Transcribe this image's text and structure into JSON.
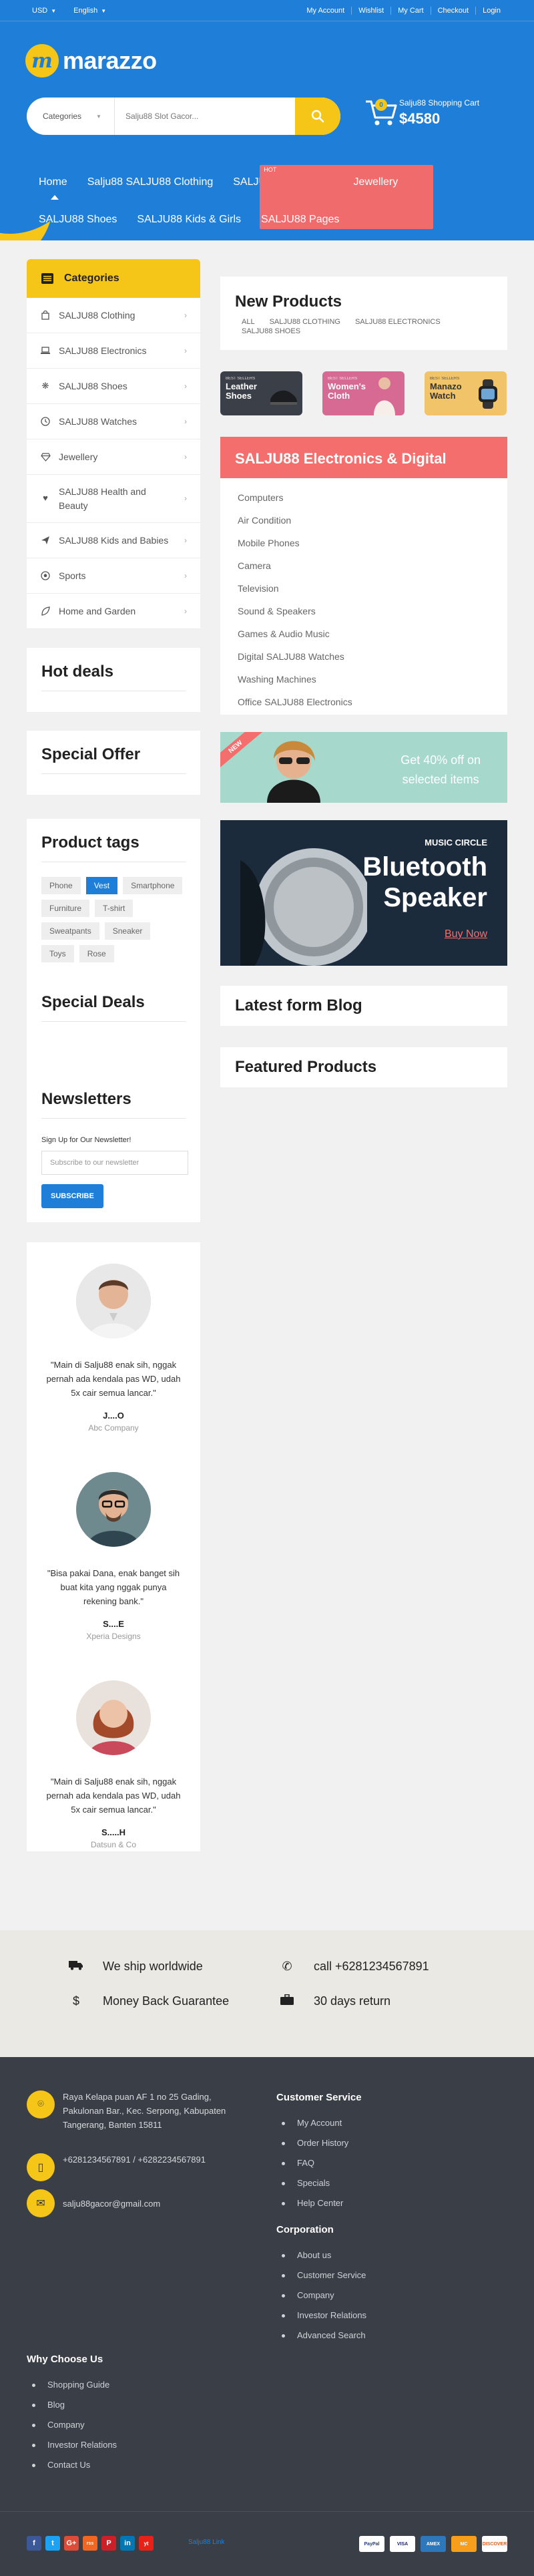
{
  "topbar": {
    "currency": "USD",
    "language": "English",
    "links": [
      "My Account",
      "Wishlist",
      "My Cart",
      "Checkout",
      "Login"
    ]
  },
  "header": {
    "logo_letter": "m",
    "logo_text": "marazzo",
    "search": {
      "category": "Categories",
      "placeholder": "Salju88 Slot Gacor..."
    },
    "cart": {
      "count": "0",
      "label": "Salju88 Shopping Cart",
      "total": "$4580"
    }
  },
  "nav": {
    "row1": [
      "Home",
      "Salju88 SALJU88 Clothing",
      "SALJU88 Electronics",
      "Jewellery"
    ],
    "row2": [
      "SALJU88 Shoes",
      "SALJU88 Kids & Girls",
      "SALJU88 Pages"
    ],
    "hot_badge": "HOT"
  },
  "categories": {
    "title": "Categories",
    "items": [
      {
        "icon": "shopping-bag-icon",
        "label": "SALJU88 Clothing"
      },
      {
        "icon": "laptop-icon",
        "label": "SALJU88 Electronics"
      },
      {
        "icon": "paw-icon",
        "label": "SALJU88 Shoes"
      },
      {
        "icon": "clock-icon",
        "label": "SALJU88 Watches"
      },
      {
        "icon": "diamond-icon",
        "label": "Jewellery"
      },
      {
        "icon": "heart-icon",
        "label": "SALJU88 Health and Beauty"
      },
      {
        "icon": "paper-plane-icon",
        "label": "SALJU88 Kids and Babies"
      },
      {
        "icon": "futbol-icon",
        "label": "Sports"
      },
      {
        "icon": "envira-icon",
        "label": "Home and Garden"
      }
    ]
  },
  "new_products": {
    "title": "New Products",
    "tabs": [
      "ALL",
      "SALJU88 CLOTHING",
      "SALJU88 ELECTRONICS",
      "SALJU88 SHOES"
    ]
  },
  "mini_banners": [
    {
      "small": "BEST SELLERS",
      "title": "Leather Shoes"
    },
    {
      "small": "BEST SELLERS",
      "title": "Women's Cloth"
    },
    {
      "small": "BEST SELLERS",
      "title": "Manazo Watch"
    }
  ],
  "electronics": {
    "title": "SALJU88 Electronics & Digital",
    "items": [
      "Computers",
      "Air Condition",
      "Mobile Phones",
      "Camera",
      "Television",
      "Sound & Speakers",
      "Games & Audio Music",
      "Digital SALJU88 Watches",
      "Washing Machines",
      "Office SALJU88 Electronics"
    ]
  },
  "offer_banner": {
    "ribbon": "NEW",
    "line1": "Get 40% off on",
    "line2": "selected items"
  },
  "bluetooth_banner": {
    "kicker": "MUSIC CIRCLE",
    "line1": "Bluetooth",
    "line2": "Speaker",
    "cta": "Buy Now"
  },
  "sections": {
    "hot_deals": "Hot deals",
    "special_offer": "Special Offer",
    "product_tags": "Product tags",
    "special_deals": "Special Deals",
    "latest_blog": "Latest form Blog",
    "featured": "Featured Products"
  },
  "tags": [
    "Phone",
    "Vest",
    "Smartphone",
    "Furniture",
    "T-shirt",
    "Sweatpants",
    "Sneaker",
    "Toys",
    "Rose"
  ],
  "active_tag": "Vest",
  "newsletter": {
    "title": "Newsletters",
    "subtitle": "Sign Up for Our Newsletter!",
    "placeholder": "Subscribe to our newsletter",
    "button": "SUBSCRIBE"
  },
  "testimonials": [
    {
      "quote": "\"Main di Salju88 enak sih, nggak pernah ada kendala pas WD, udah 5x cair semua lancar.\"",
      "name": "J....O",
      "company": "Abc Company"
    },
    {
      "quote": "\"Bisa pakai Dana, enak banget sih buat kita yang nggak punya rekening bank.\"",
      "name": "S....E",
      "company": "Xperia Designs"
    },
    {
      "quote": "\"Main di Salju88 enak sih, nggak pernah ada kendala pas WD, udah 5x cair semua lancar.\"",
      "name": "S.....H",
      "company": "Datsun & Co"
    }
  ],
  "ship": {
    "items": [
      {
        "icon": "truck-icon",
        "label": "We ship worldwide"
      },
      {
        "icon": "phone-icon",
        "label": "call +6281234567891"
      },
      {
        "icon": "dollar-icon",
        "label": "Money Back Guarantee"
      },
      {
        "icon": "briefcase-icon",
        "label": "30 days return"
      }
    ]
  },
  "footer": {
    "address": "Raya Kelapa puan AF 1 no 25 Gading, Pakulonan Bar., Kec. Serpong, Kabupaten Tangerang, Banten 15811",
    "phone": "+6281234567891 / +6282234567891",
    "email": "salju88gacor@gmail.com",
    "customer_service": {
      "title": "Customer Service",
      "links": [
        "My Account",
        "Order History",
        "FAQ",
        "Specials",
        "Help Center"
      ]
    },
    "corporation": {
      "title": "Corporation",
      "links": [
        "About us",
        "Customer Service",
        "Company",
        "Investor Relations",
        "Advanced Search"
      ]
    },
    "why": {
      "title": "Why Choose Us",
      "links": [
        "Shopping Guide",
        "Blog",
        "Company",
        "Investor Relations",
        "Contact Us"
      ]
    },
    "socials": [
      "f",
      "t",
      "G+",
      "rss",
      "P",
      "in",
      "yt"
    ],
    "sign": "Salju88 Link",
    "payments": [
      "PayPal",
      "VISA",
      "AMEX",
      "MC",
      "DISCOVER"
    ]
  },
  "colors": {
    "primary": "#1f7fd8",
    "accent_yellow": "#f5c518",
    "accent_red": "#f46e6e",
    "footer_bg": "#3a3f47"
  }
}
